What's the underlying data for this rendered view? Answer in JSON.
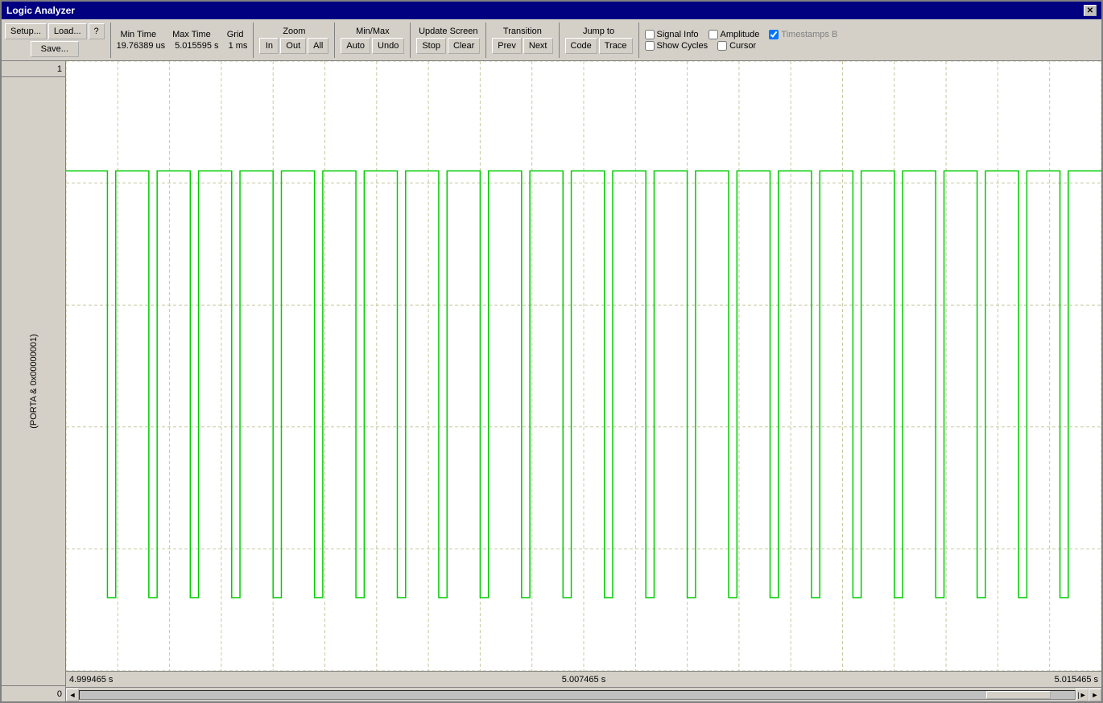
{
  "window": {
    "title": "Logic Analyzer",
    "close_label": "✕"
  },
  "toolbar": {
    "setup_label": "Setup...",
    "load_label": "Load...",
    "save_label": "Save...",
    "help_label": "?",
    "min_time_label": "Min Time",
    "min_time_value": "19.76389 us",
    "max_time_label": "Max Time",
    "max_time_value": "5.015595 s",
    "grid_label": "Grid",
    "grid_value": "1 ms",
    "zoom_label": "Zoom",
    "zoom_in": "In",
    "zoom_out": "Out",
    "zoom_all": "All",
    "minmax_label": "Min/Max",
    "minmax_auto": "Auto",
    "minmax_undo": "Undo",
    "update_screen_label": "Update Screen",
    "update_stop": "Stop",
    "update_clear": "Clear",
    "transition_label": "Transition",
    "transition_prev": "Prev",
    "transition_next": "Next",
    "jump_label": "Jump to",
    "jump_code": "Code",
    "jump_trace": "Trace",
    "signal_info_label": "Signal Info",
    "show_cycles_label": "Show Cycles",
    "amplitude_label": "Amplitude",
    "cursor_label": "Cursor",
    "timestamps_label": "Timestamps B",
    "signal_info_checked": false,
    "show_cycles_checked": false,
    "amplitude_checked": false,
    "cursor_checked": false,
    "timestamps_checked": true
  },
  "waveform": {
    "signal_top_value": "1",
    "signal_bottom_value": "0",
    "signal_name": "(PORTA & 0x00000001)",
    "time_labels": [
      {
        "text": "4.999465 s",
        "position_percent": 0
      },
      {
        "text": "5.007465 s",
        "position_percent": 50
      },
      {
        "text": "5.015465 s",
        "position_percent": 100
      }
    ],
    "grid_columns": 20,
    "pulse_positions_percent": [
      4,
      8,
      12,
      16,
      20,
      24,
      28,
      32,
      36,
      40,
      44,
      48,
      52,
      56,
      60,
      64,
      68,
      72,
      76,
      80,
      84,
      88,
      92,
      96
    ]
  }
}
